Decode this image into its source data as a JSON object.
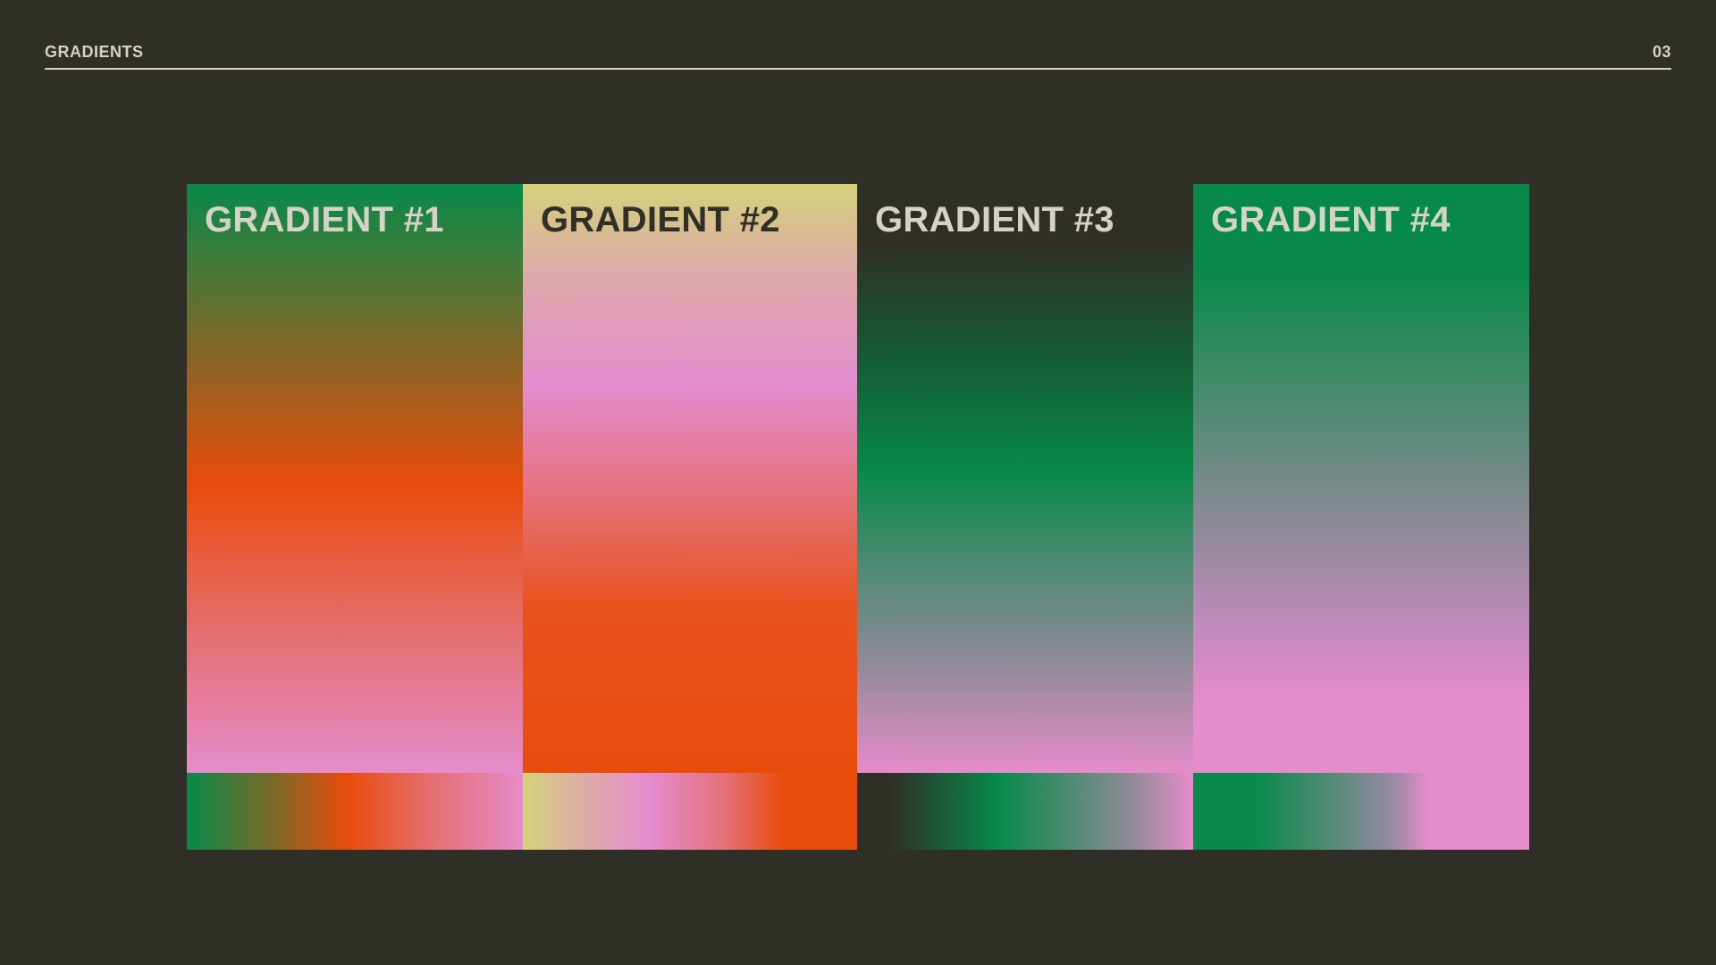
{
  "header": {
    "title": "GRADIENTS",
    "page_number": "03"
  },
  "colors": {
    "background": "#2f2f28",
    "text_light": "#d6d2c6",
    "green": "#078a49",
    "orange": "#e84c0b",
    "pink": "#e58ccb",
    "yellow": "#d6d27a"
  },
  "gradients": [
    {
      "label": "GRADIENT #1"
    },
    {
      "label": "GRADIENT #2"
    },
    {
      "label": "GRADIENT #3"
    },
    {
      "label": "GRADIENT #4"
    }
  ]
}
